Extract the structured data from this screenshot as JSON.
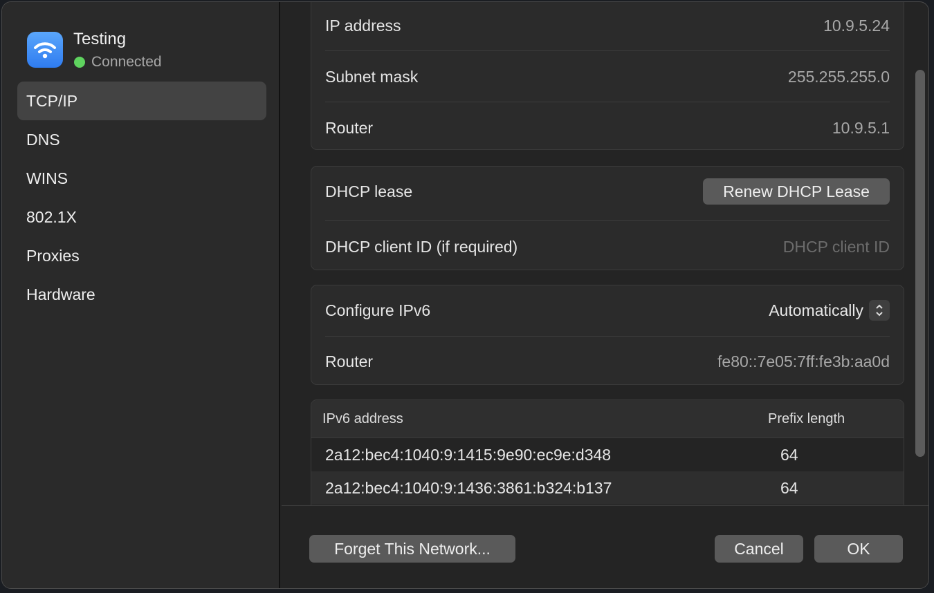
{
  "sidebar": {
    "network_name": "Testing",
    "status": "Connected",
    "status_color": "#5fd35f",
    "icon": "wifi-icon",
    "items": [
      {
        "label": "TCP/IP",
        "active": true
      },
      {
        "label": "DNS"
      },
      {
        "label": "WINS"
      },
      {
        "label": "802.1X"
      },
      {
        "label": "Proxies"
      },
      {
        "label": "Hardware"
      }
    ]
  },
  "ipv4": {
    "ip_label": "IP address",
    "ip_value": "10.9.5.24",
    "subnet_label": "Subnet mask",
    "subnet_value": "255.255.255.0",
    "router_label": "Router",
    "router_value": "10.9.5.1"
  },
  "dhcp": {
    "lease_label": "DHCP lease",
    "renew_button": "Renew DHCP Lease",
    "client_id_label": "DHCP client ID (if required)",
    "client_id_placeholder": "DHCP client ID",
    "client_id_value": ""
  },
  "ipv6": {
    "configure_label": "Configure IPv6",
    "configure_value": "Automatically",
    "router_label": "Router",
    "router_value": "fe80::7e05:7ff:fe3b:aa0d"
  },
  "ipv6_table": {
    "headers": [
      "IPv6 address",
      "Prefix length"
    ],
    "rows": [
      [
        "2a12:bec4:1040:9:1415:9e90:ec9e:d348",
        "64"
      ],
      [
        "2a12:bec4:1040:9:1436:3861:b324:b137",
        "64"
      ]
    ]
  },
  "footer": {
    "forget": "Forget This Network...",
    "cancel": "Cancel",
    "ok": "OK"
  }
}
